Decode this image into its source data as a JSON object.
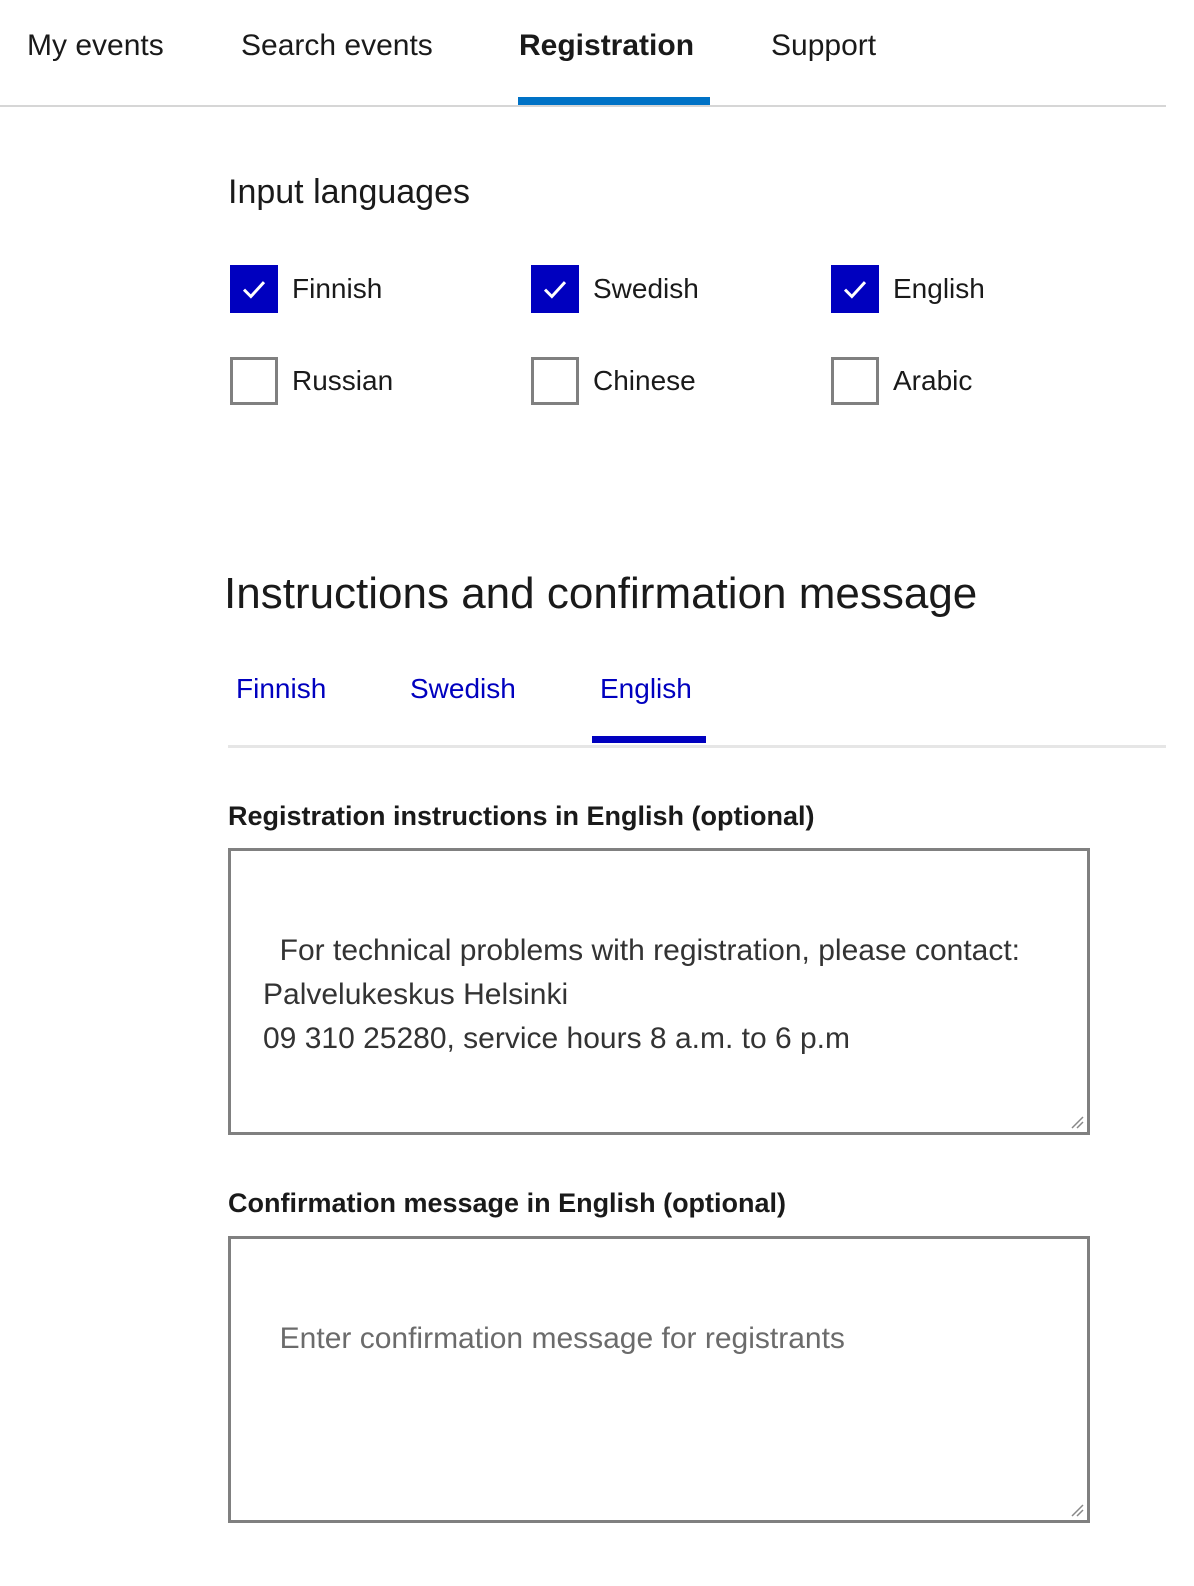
{
  "nav": {
    "items": [
      {
        "label": "My events",
        "active": false
      },
      {
        "label": "Search events",
        "active": false
      },
      {
        "label": "Registration",
        "active": true
      },
      {
        "label": "Support",
        "active": false
      }
    ]
  },
  "input_languages": {
    "title": "Input languages",
    "options": [
      {
        "label": "Finnish",
        "checked": true
      },
      {
        "label": "Swedish",
        "checked": true
      },
      {
        "label": "English",
        "checked": true
      },
      {
        "label": "Russian",
        "checked": false
      },
      {
        "label": "Chinese",
        "checked": false
      },
      {
        "label": "Arabic",
        "checked": false
      }
    ]
  },
  "instructions": {
    "title": "Instructions and confirmation message",
    "tabs": [
      {
        "label": "Finnish",
        "active": false
      },
      {
        "label": "Swedish",
        "active": false
      },
      {
        "label": "English",
        "active": true
      }
    ],
    "registration_label": "Registration instructions in English (optional)",
    "registration_value": "For technical problems with registration, please contact:\nPalvelukeskus Helsinki\n09 310 25280, service hours 8 a.m. to 6 p.m",
    "confirmation_label": "Confirmation message in English (optional)",
    "confirmation_value": "",
    "confirmation_placeholder": "Enter confirmation message for registrants"
  },
  "colors": {
    "nav_accent": "#0072c6",
    "checkbox_checked": "#0000bf",
    "tab_text": "#0000bf",
    "border": "#808080"
  }
}
